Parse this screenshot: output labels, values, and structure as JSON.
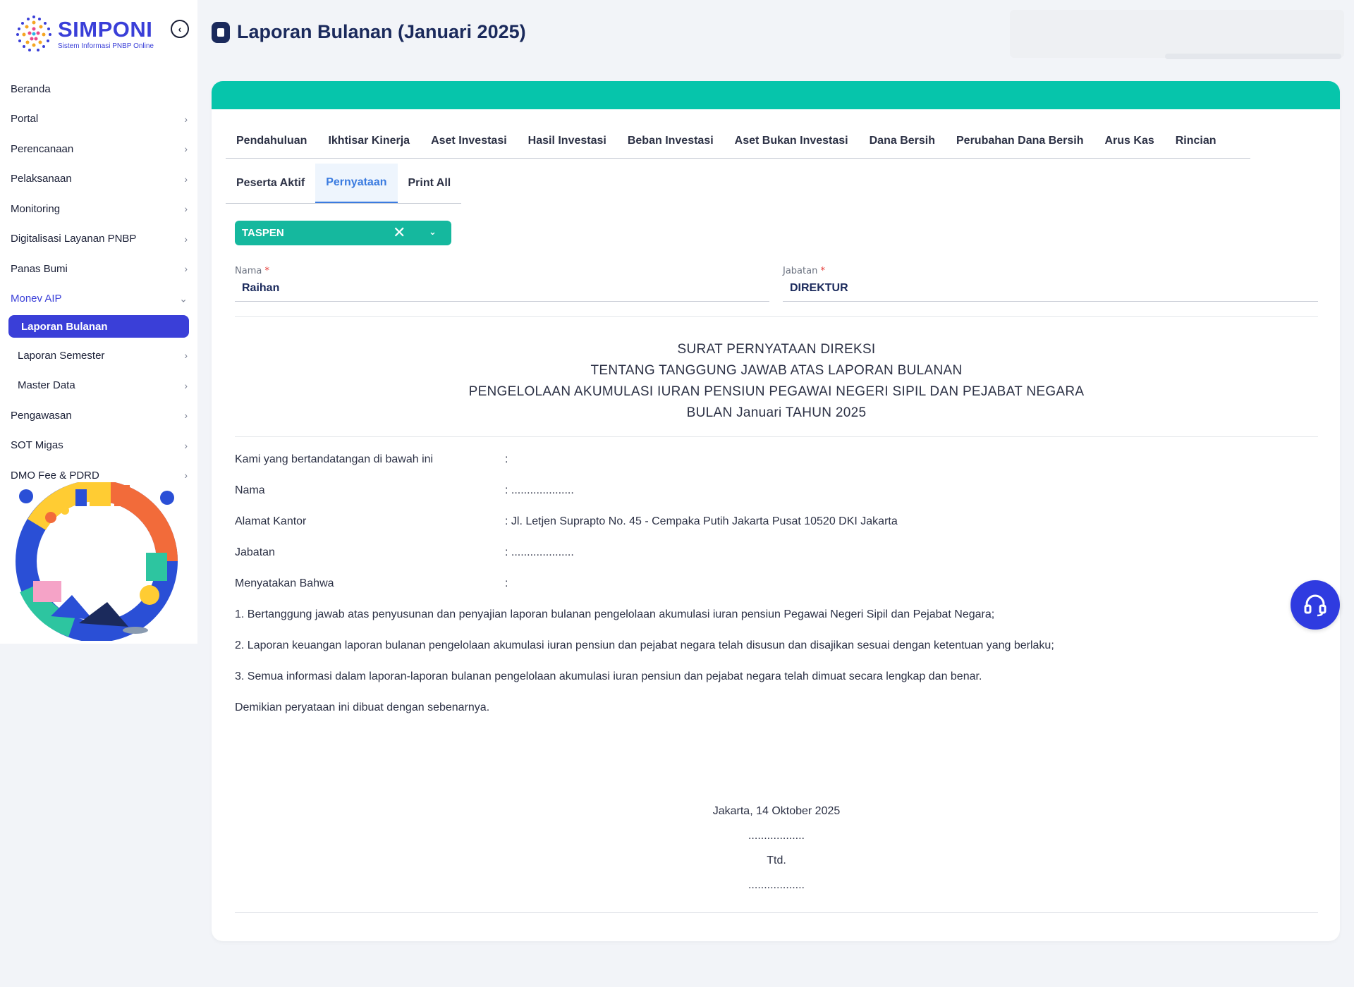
{
  "brand": {
    "name": "SIMPONI",
    "subtitle": "Sistem Informasi PNBP Online"
  },
  "sidebar": {
    "items": [
      {
        "label": "Beranda"
      },
      {
        "label": "Portal"
      },
      {
        "label": "Perencanaan"
      },
      {
        "label": "Pelaksanaan"
      },
      {
        "label": "Monitoring"
      },
      {
        "label": "Digitalisasi Layanan PNBP"
      },
      {
        "label": "Panas Bumi"
      },
      {
        "label": "Monev AIP"
      },
      {
        "label": "Laporan Bulanan"
      },
      {
        "label": "Laporan Semester"
      },
      {
        "label": "Master Data"
      },
      {
        "label": "Pengawasan"
      },
      {
        "label": "SOT Migas"
      },
      {
        "label": "DMO Fee & PDRD"
      }
    ],
    "active": "Laporan Bulanan"
  },
  "page": {
    "title": "Laporan Bulanan (Januari 2025)"
  },
  "tabs_row1": [
    "Pendahuluan",
    "Ikhtisar Kinerja",
    "Aset Investasi",
    "Hasil Investasi",
    "Beban Investasi",
    "Aset Bukan Investasi",
    "Dana Bersih",
    "Perubahan Dana Bersih",
    "Arus Kas",
    "Rincian"
  ],
  "tabs_row2": [
    "Peserta Aktif",
    "Pernyataan",
    "Print All"
  ],
  "active_tab": "Pernyataan",
  "select": {
    "value": "TASPEN"
  },
  "form": {
    "nama_label": "Nama",
    "nama_value": "Raihan",
    "jabatan_label": "Jabatan",
    "jabatan_value": "DIREKTUR",
    "required_mark": "*"
  },
  "document": {
    "title_lines": [
      "SURAT PERNYATAAN DIREKSI",
      "TENTANG TANGGUNG JAWAB ATAS LAPORAN BULANAN",
      "PENGELOLAAN AKUMULASI IURAN PENSIUN PEGAWAI NEGERI SIPIL DAN PEJABAT NEGARA",
      "BULAN Januari TAHUN 2025"
    ],
    "rows": [
      {
        "key": "Kami yang bertandatangan di bawah ini",
        "value": ":"
      },
      {
        "key": "Nama",
        "value": ": ...................."
      },
      {
        "key": "Alamat Kantor",
        "value": ": Jl. Letjen Suprapto No. 45 - Cempaka Putih Jakarta Pusat 10520 DKI Jakarta"
      },
      {
        "key": "Jabatan",
        "value": ": ...................."
      },
      {
        "key": "Menyatakan Bahwa",
        "value": ":"
      }
    ],
    "statements": [
      "1. Bertanggung jawab atas penyusunan dan penyajian laporan bulanan pengelolaan akumulasi iuran pensiun Pegawai Negeri Sipil dan Pejabat Negara;",
      "2. Laporan keuangan laporan bulanan pengelolaan akumulasi iuran pensiun dan pejabat negara telah disusun dan disajikan sesuai dengan ketentuan yang berlaku;",
      "3. Semua informasi dalam laporan-laporan bulanan pengelolaan akumulasi iuran pensiun dan pejabat negara telah dimuat secara lengkap dan benar.",
      "Demikian peryataan ini dibuat dengan sebenarnya."
    ],
    "signature": {
      "place_date": "Jakarta, 14 Oktober 2025",
      "dots1": "..................",
      "ttd": "Ttd.",
      "dots2": ".................."
    }
  },
  "colors": {
    "accent": "#3a3fd8",
    "teal": "#06c5ab",
    "select": "#15b89e",
    "navy": "#1b2a5c",
    "help": "#2f3be0"
  },
  "icons": [
    "brand-logo-icon",
    "collapse-chevron-icon",
    "chevron-right-icon",
    "chevron-down-icon",
    "document-icon",
    "clear-x-icon",
    "dropdown-arrow-icon",
    "headset-icon"
  ]
}
